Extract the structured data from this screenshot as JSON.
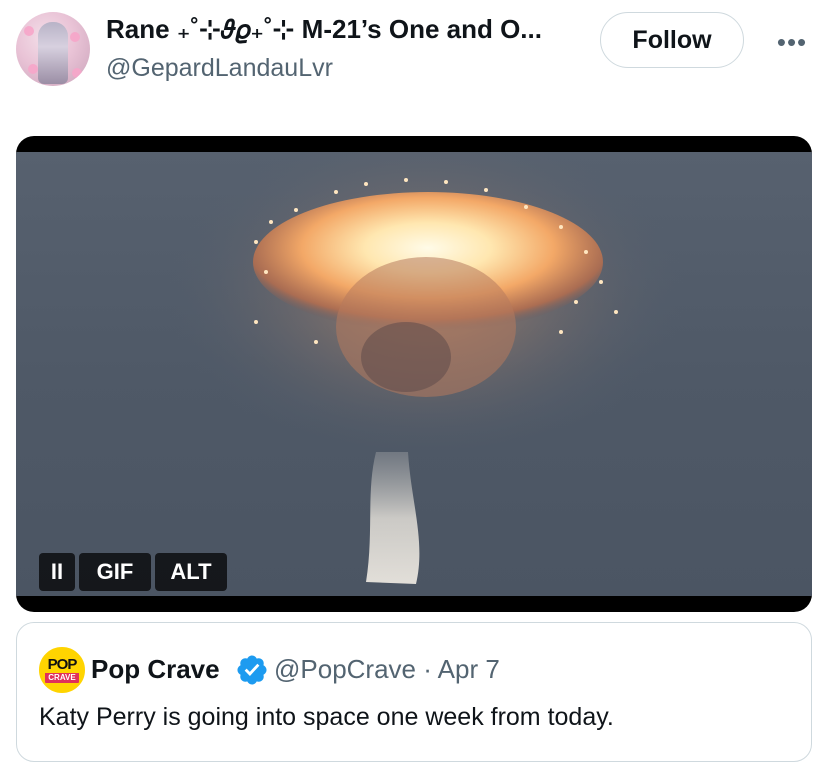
{
  "post": {
    "author": {
      "display_name": "Rane ₊˚⊹𝜗𝜚₊˚⊹ M-21’s One and O...",
      "handle": "@GepardLandauLvr",
      "avatar_icon": "anime-avatar-icon"
    },
    "follow_label": "Follow",
    "more_icon": "more-dots-icon",
    "more_glyph": "•••"
  },
  "media": {
    "type": "GIF",
    "pause_glyph": "II",
    "gif_label": "GIF",
    "alt_label": "ALT",
    "subject": "rocket explosion in sky"
  },
  "quoted_post": {
    "author_name": "Pop Crave",
    "verified": true,
    "handle_and_date": "@PopCrave · Apr 7",
    "text": "Katy Perry is going into space one week from today.",
    "avatar": {
      "top": "POP",
      "bottom": "CRAVE"
    }
  },
  "colors": {
    "text_primary": "#0f1419",
    "text_secondary": "#536471",
    "border": "#cfd9de",
    "verified_blue": "#1d9bf0"
  }
}
